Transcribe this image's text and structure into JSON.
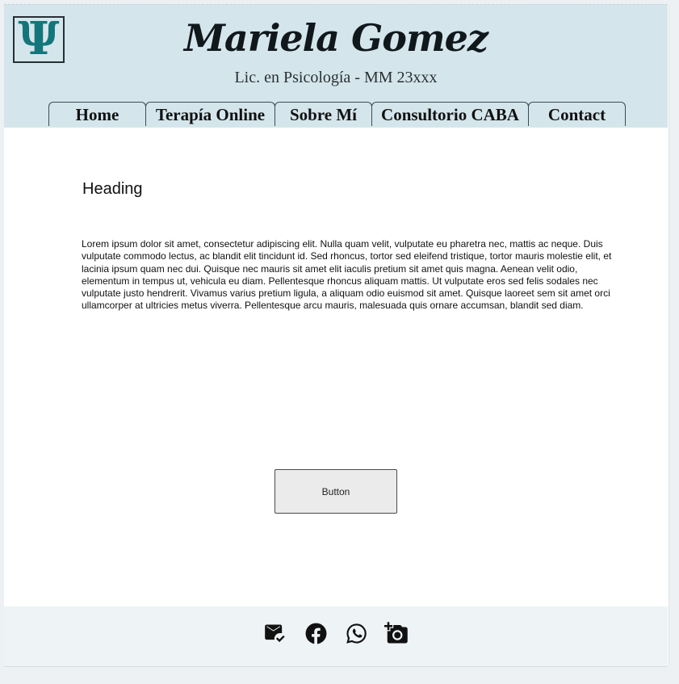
{
  "brand": {
    "logo_glyph": "Ψ",
    "name": "Mariela Gomez",
    "subtitle": "Lic. en Psicología - MM 23xxx",
    "header_color": "#d4e6ec",
    "logo_color": "#14767a"
  },
  "nav": {
    "items": [
      {
        "label": "Home"
      },
      {
        "label": "Terapía Online"
      },
      {
        "label": "Sobre Mí"
      },
      {
        "label": "Consultorio CABA"
      },
      {
        "label": "Contact"
      }
    ]
  },
  "main": {
    "heading": "Heading",
    "body": "Lorem ipsum dolor sit amet, consectetur adipiscing elit. Nulla quam velit, vulputate eu pharetra nec, mattis ac neque. Duis vulputate commodo lectus, ac blandit elit tincidunt id. Sed rhoncus, tortor sed eleifend tristique, tortor mauris molestie elit, et lacinia ipsum quam nec dui. Quisque nec mauris sit amet elit iaculis pretium sit amet quis magna. Aenean velit odio, elementum in tempus ut, vehicula eu diam. Pellentesque rhoncus aliquam mattis. Ut vulputate eros sed felis sodales nec vulputate justo hendrerit. Vivamus varius pretium ligula, a aliquam odio euismod sit amet. Quisque laoreet sem sit amet orci ullamcorper at ultricies metus viverra. Pellentesque arcu mauris, malesuada quis ornare accumsan, blandit sed diam.",
    "button_label": "Button"
  },
  "footer": {
    "icons": [
      "mark-email-read-icon",
      "facebook-icon",
      "whatsapp-icon",
      "add-a-photo-icon"
    ]
  }
}
